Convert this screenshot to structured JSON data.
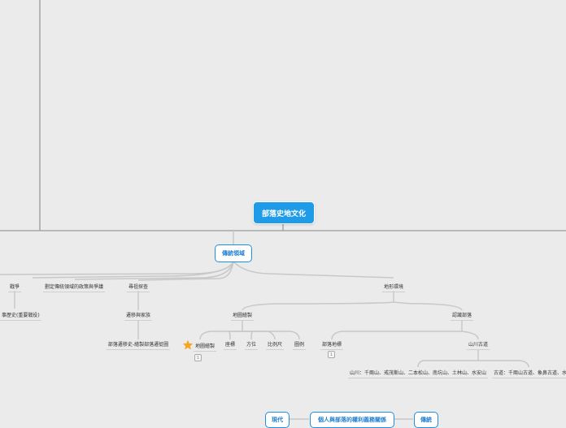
{
  "root": {
    "label": "部落史地文化"
  },
  "main": {
    "label": "傳統領域"
  },
  "level1": {
    "war": "戰爭",
    "war_child": "事歷史(重要戰役)",
    "policy": "劃定傳統領域的政策與爭議",
    "seek": "尋祖探查",
    "seek_child": "遷移與家族",
    "seek_grandchild": "部落遷移史-繪製部落遷徙圖",
    "geo": "地形環境"
  },
  "map": {
    "label": "地圖繪製",
    "star_label": "地圖繪製",
    "items": [
      "座標",
      "方位",
      "比例尺",
      "圖例"
    ]
  },
  "recognize": {
    "label": "認識部落",
    "landmark": "部落地標",
    "trail": "山川古道",
    "mountains": "山川：千兩山、戒茂斯山、二本松山、南坑山、土林山、水安山",
    "roads": "古道：千兩山古道、象鼻古道、水安"
  },
  "bottom": {
    "modern": "現代",
    "center": "個人與部落的權利義務關係",
    "traditional": "傳統"
  },
  "badges": {
    "note1": "1",
    "note2": "1"
  }
}
